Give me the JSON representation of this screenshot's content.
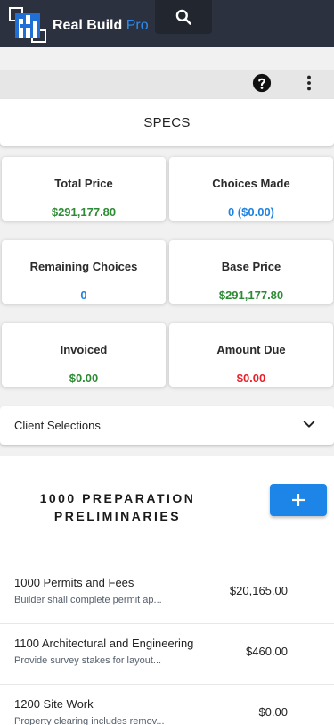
{
  "brand": {
    "name": "Real Build",
    "suffix": "Pro"
  },
  "specs": {
    "title": "SPECS"
  },
  "stats": [
    {
      "label": "Total Price",
      "value": "$291,177.80",
      "color": "#2e8b35"
    },
    {
      "label": "Choices Made",
      "value": "0 ($0.00)",
      "color": "#1f82e0"
    },
    {
      "label": "Remaining Choices",
      "value": "0",
      "color": "#1f82e0"
    },
    {
      "label": "Base Price",
      "value": "$291,177.80",
      "color": "#2e8b35"
    },
    {
      "label": "Invoiced",
      "value": "$0.00",
      "color": "#2e8b35"
    },
    {
      "label": "Amount Due",
      "value": "$0.00",
      "color": "#e8202a"
    }
  ],
  "client_selections": {
    "label": "Client Selections"
  },
  "section": {
    "title_line1": "1000 PREPARATION",
    "title_line2": "PRELIMINARIES",
    "items": [
      {
        "name": "1000 Permits and Fees",
        "desc": "Builder shall complete permit ap...",
        "amount": "$20,165.00"
      },
      {
        "name": "1100 Architectural and Engineering",
        "desc": "Provide survey stakes for layout...",
        "amount": "$460.00"
      },
      {
        "name": "1200 Site Work",
        "desc": "Property clearing includes remov...",
        "amount": "$0.00"
      }
    ]
  },
  "icons": {
    "search": "search-icon",
    "help": "help-circle-icon",
    "more": "more-vertical-icon",
    "chevron": "chevron-down-icon",
    "add": "plus-icon"
  },
  "colors": {
    "appbar": "#2c3140",
    "accent": "#1e85e8",
    "positive": "#2e8b35",
    "negative": "#e8202a"
  }
}
